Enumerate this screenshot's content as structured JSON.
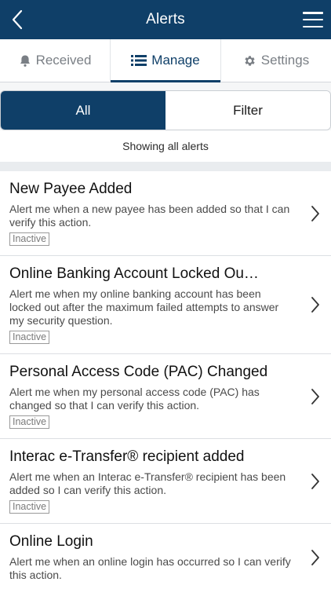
{
  "header": {
    "title": "Alerts"
  },
  "tabs": [
    {
      "label": "Received",
      "icon": "bell-icon"
    },
    {
      "label": "Manage",
      "icon": "list-icon",
      "active": true
    },
    {
      "label": "Settings",
      "icon": "gear-icon"
    }
  ],
  "segmented": {
    "all_label": "All",
    "filter_label": "Filter"
  },
  "showing_text": "Showing all alerts",
  "alerts": [
    {
      "title": "New Payee Added",
      "description": "Alert me when a new payee has been added so that I can verify this action.",
      "status": "Inactive"
    },
    {
      "title": "Online Banking Account Locked Ou…",
      "description": "Alert me when my online banking account has been locked out after the maximum failed attempts to answer my security question.",
      "status": "Inactive"
    },
    {
      "title": "Personal Access Code (PAC) Changed",
      "description": "Alert me when my personal access code (PAC) has changed so that I can verify this action.",
      "status": "Inactive"
    },
    {
      "title": "Interac e-Transfer® recipient added",
      "description": "Alert me when an Interac e-Transfer® recipient has been added so I can verify this action.",
      "status": "Inactive"
    },
    {
      "title": "Online Login",
      "description": "Alert me when an online login has occurred so I can verify this action.",
      "status": ""
    }
  ],
  "colors": {
    "brand": "#0f3f68",
    "background": "#e9ecef"
  }
}
